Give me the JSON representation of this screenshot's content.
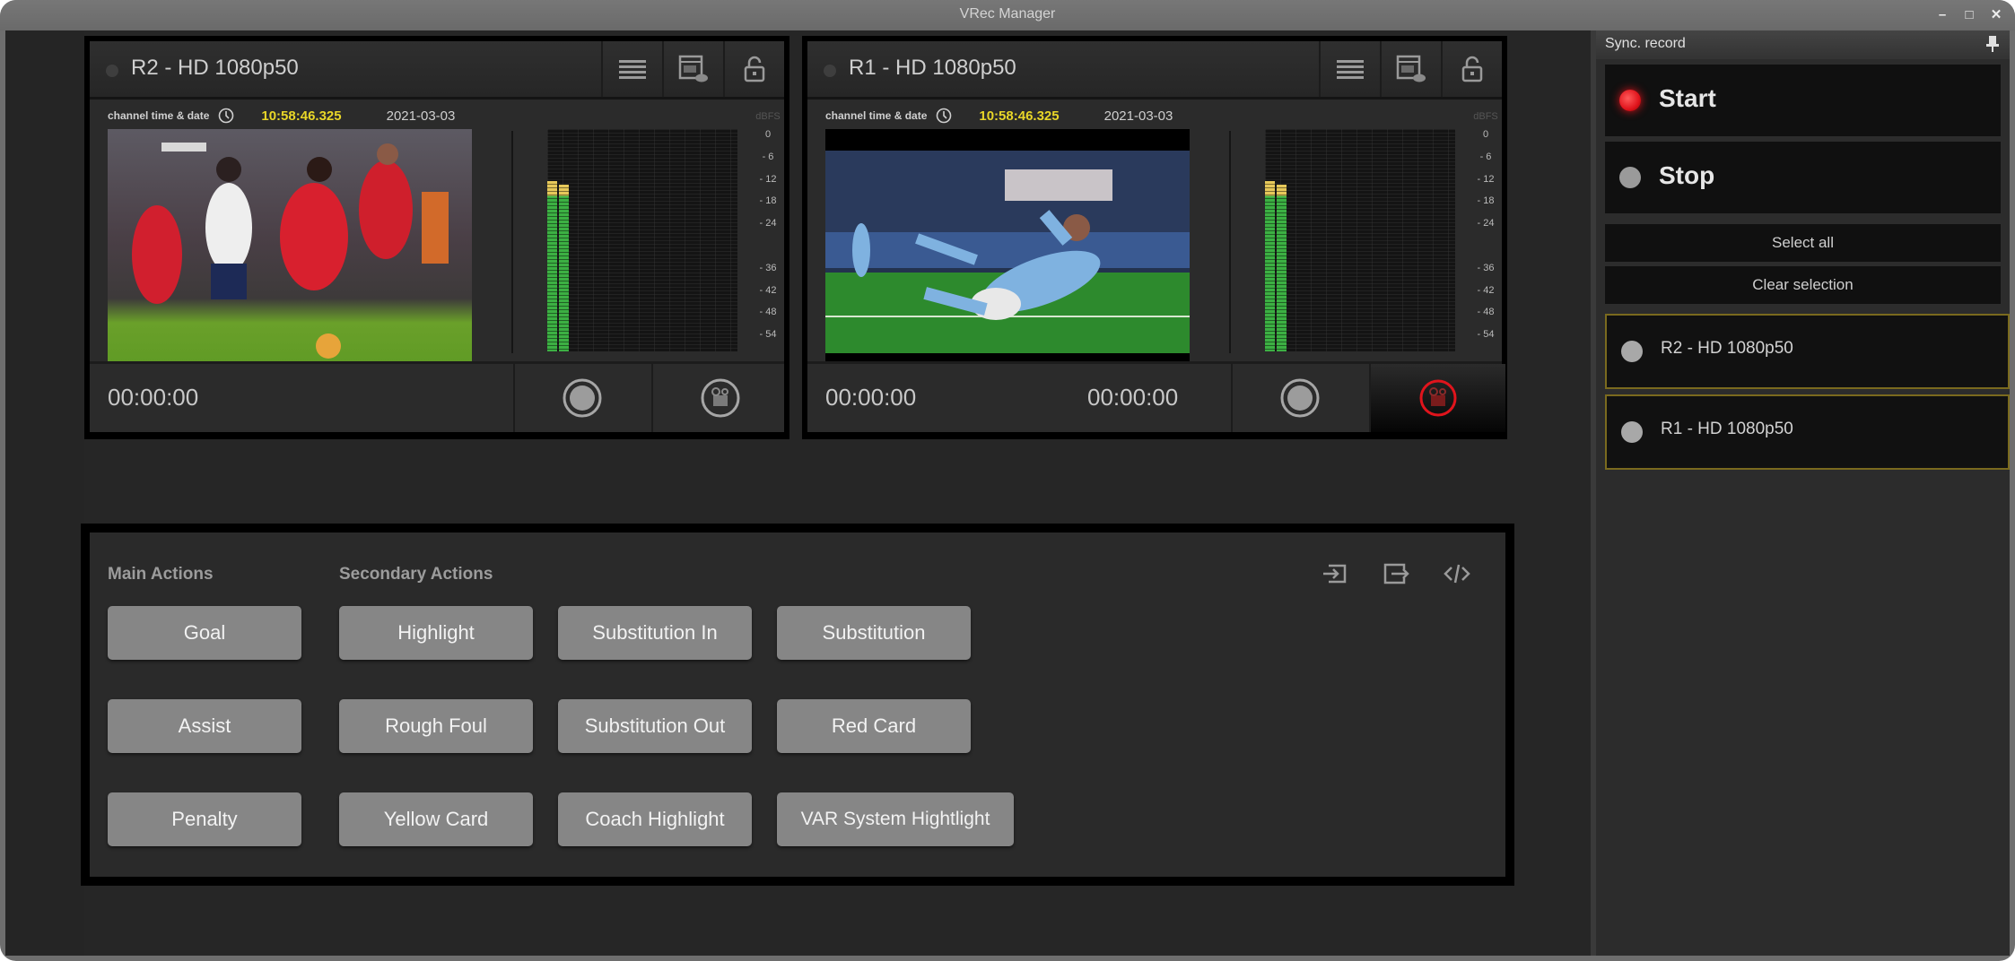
{
  "window": {
    "title": "VRec Manager",
    "controls": {
      "minimize": "–",
      "maximize": "□",
      "close": "✕"
    }
  },
  "channels": [
    {
      "id": "r2",
      "title": "R2 - HD 1080p50",
      "info_label": "channel  time & date",
      "time": "10:58:46.325",
      "date": "2021-03-03",
      "video_description": "Soccer match – red team vs white team",
      "timecode_left": "00:00:00",
      "timecode_right": "",
      "recording_active": false,
      "meter": {
        "unit": "dBFS",
        "scale": [
          "0",
          "- 6",
          "- 12",
          "- 18",
          "- 24",
          "- 36",
          "- 42",
          "- 48",
          "- 54"
        ],
        "level_left_db": -14,
        "level_right_db": -15
      }
    },
    {
      "id": "r1",
      "title": "R1 - HD 1080p50",
      "info_label": "channel  time & date",
      "time": "10:58:46.325",
      "date": "2021-03-03",
      "video_description": "Soccer player in light blue celebrating with a slide",
      "timecode_left": "00:00:00",
      "timecode_right": "00:00:00",
      "recording_active": true,
      "meter": {
        "unit": "dBFS",
        "scale": [
          "0",
          "- 6",
          "- 12",
          "- 18",
          "- 24",
          "- 36",
          "- 42",
          "- 48",
          "- 54"
        ],
        "level_left_db": -14,
        "level_right_db": -15
      }
    }
  ],
  "channel_tools": [
    "list-icon",
    "preview-settings-icon",
    "unlock-icon"
  ],
  "actions": {
    "main_heading": "Main Actions",
    "secondary_heading": "Secondary Actions",
    "main": [
      "Goal",
      "Assist",
      "Penalty"
    ],
    "secondary": [
      [
        "Highlight",
        "Substitution In",
        "Substitution"
      ],
      [
        "Rough Foul",
        "Substitution Out",
        "Red Card"
      ],
      [
        "Yellow Card",
        "Coach Highlight",
        "VAR System Hightlight"
      ]
    ],
    "toolbar_icons": [
      "import-icon",
      "export-icon",
      "code-icon"
    ]
  },
  "sync_record": {
    "title": "Sync. record",
    "start_label": "Start",
    "stop_label": "Stop",
    "select_all_label": "Select all",
    "clear_selection_label": "Clear selection",
    "channels": [
      "R2 - HD 1080p50",
      "R1 - HD 1080p50"
    ],
    "colors": {
      "start_led": "#e0141c",
      "stop_led": "#9a9a9a",
      "selected_border": "#7a6a1e"
    }
  },
  "colors": {
    "time_accent": "#e8d628",
    "record_active": "#e0141c",
    "meter_green": "#3cb043",
    "meter_yellow": "#e6c85a"
  }
}
